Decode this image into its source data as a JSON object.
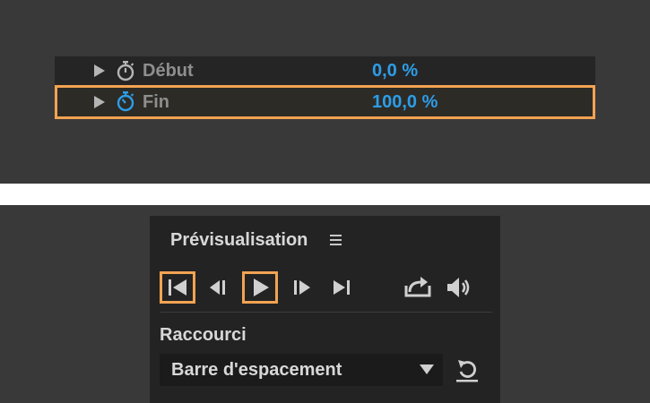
{
  "properties": {
    "rows": [
      {
        "name": "Début",
        "value": "0,0 %",
        "stopwatch_active": false
      },
      {
        "name": "Fin",
        "value": "100,0 %",
        "stopwatch_active": true
      }
    ]
  },
  "preview": {
    "title": "Prévisualisation",
    "transport": [
      {
        "icon": "first-frame-icon",
        "highlighted": true
      },
      {
        "icon": "previous-frame-icon",
        "highlighted": false
      },
      {
        "icon": "play-icon",
        "highlighted": true
      },
      {
        "icon": "next-frame-icon",
        "highlighted": false
      },
      {
        "icon": "last-frame-icon",
        "highlighted": false
      },
      {
        "icon": "export-icon",
        "highlighted": false
      },
      {
        "icon": "speaker-icon",
        "highlighted": false
      }
    ],
    "shortcut_label": "Raccourci",
    "shortcut_value": "Barre d'espacement"
  },
  "colors": {
    "highlight": "#f2a352",
    "value_blue": "#2d9de8",
    "text_light": "#d8d8d8",
    "text_dim": "#8e8e8e"
  }
}
